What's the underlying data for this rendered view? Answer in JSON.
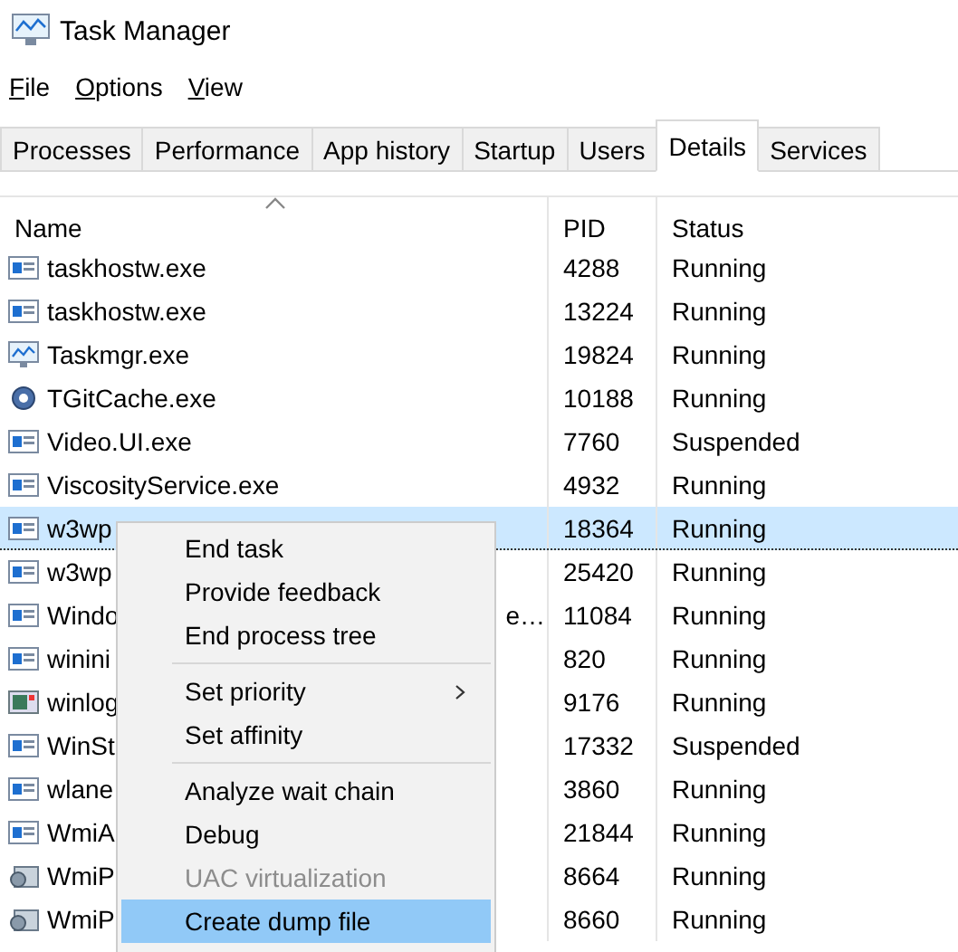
{
  "window": {
    "title": "Task Manager"
  },
  "menu_bar": [
    {
      "label": "File"
    },
    {
      "label": "Options"
    },
    {
      "label": "View"
    }
  ],
  "tabs": [
    {
      "label": "Processes",
      "selected": false
    },
    {
      "label": "Performance",
      "selected": false
    },
    {
      "label": "App history",
      "selected": false
    },
    {
      "label": "Startup",
      "selected": false
    },
    {
      "label": "Users",
      "selected": false
    },
    {
      "label": "Details",
      "selected": true
    },
    {
      "label": "Services",
      "selected": false
    }
  ],
  "table": {
    "columns": [
      "Name",
      "PID",
      "Status"
    ],
    "rows": [
      {
        "kind": "app",
        "name": "taskhostw.exe",
        "pid": "4288",
        "status": "Running",
        "selected": false
      },
      {
        "kind": "app",
        "name": "taskhostw.exe",
        "pid": "13224",
        "status": "Running",
        "selected": false
      },
      {
        "kind": "monitor",
        "name": "Taskmgr.exe",
        "pid": "19824",
        "status": "Running",
        "selected": false
      },
      {
        "kind": "gear",
        "name": "TGitCache.exe",
        "pid": "10188",
        "status": "Running",
        "selected": false
      },
      {
        "kind": "app",
        "name": "Video.UI.exe",
        "pid": "7760",
        "status": "Suspended",
        "selected": false
      },
      {
        "kind": "app",
        "name": "ViscosityService.exe",
        "pid": "4932",
        "status": "Running",
        "selected": false
      },
      {
        "kind": "app",
        "name": "w3wp",
        "pid": "18364",
        "status": "Running",
        "selected": true
      },
      {
        "kind": "app",
        "name": "w3wp",
        "pid": "25420",
        "status": "Running",
        "selected": false
      },
      {
        "kind": "app",
        "name": "Windo",
        "name_end": "e…",
        "pid": "11084",
        "status": "Running",
        "selected": false
      },
      {
        "kind": "app",
        "name": "winini",
        "pid": "820",
        "status": "Running",
        "selected": false
      },
      {
        "kind": "screen",
        "name": "winlog",
        "pid": "9176",
        "status": "Running",
        "selected": false
      },
      {
        "kind": "app",
        "name": "WinSt",
        "pid": "17332",
        "status": "Suspended",
        "selected": false
      },
      {
        "kind": "app",
        "name": "wlane",
        "pid": "3860",
        "status": "Running",
        "selected": false
      },
      {
        "kind": "app",
        "name": "WmiA",
        "pid": "21844",
        "status": "Running",
        "selected": false
      },
      {
        "kind": "service",
        "name": "WmiP",
        "pid": "8664",
        "status": "Running",
        "selected": false
      },
      {
        "kind": "service",
        "name": "WmiP",
        "pid": "8660",
        "status": "Running",
        "selected": false
      }
    ]
  },
  "context_menu": [
    {
      "kind": "item",
      "label": "End task",
      "disabled": false,
      "selected": false
    },
    {
      "kind": "item",
      "label": "Provide feedback",
      "disabled": false,
      "selected": false
    },
    {
      "kind": "item",
      "label": "End process tree",
      "disabled": false,
      "selected": false
    },
    {
      "kind": "separator"
    },
    {
      "kind": "submenu",
      "label": "Set priority",
      "disabled": false,
      "selected": false
    },
    {
      "kind": "item",
      "label": "Set affinity",
      "disabled": false,
      "selected": false
    },
    {
      "kind": "separator"
    },
    {
      "kind": "item",
      "label": "Analyze wait chain",
      "disabled": false,
      "selected": false
    },
    {
      "kind": "item",
      "label": "Debug",
      "disabled": false,
      "selected": false
    },
    {
      "kind": "item",
      "label": "UAC virtualization",
      "disabled": true,
      "selected": false
    },
    {
      "kind": "item",
      "label": "Create dump file",
      "disabled": false,
      "selected": true
    }
  ]
}
